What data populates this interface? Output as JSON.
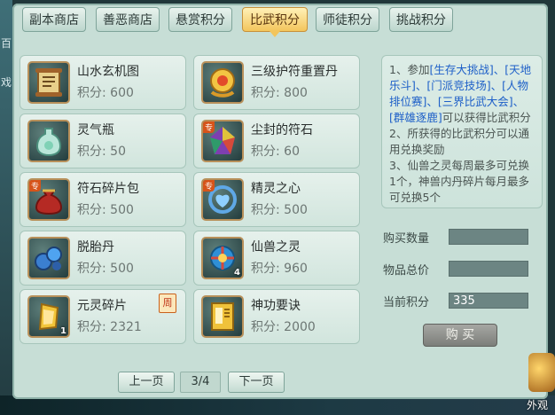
{
  "left_edge": [
    "百",
    "戏"
  ],
  "tabs": [
    {
      "label": "副本商店",
      "active": false
    },
    {
      "label": "善恶商店",
      "active": false
    },
    {
      "label": "悬赏积分",
      "active": false
    },
    {
      "label": "比武积分",
      "active": true
    },
    {
      "label": "师徒积分",
      "active": false
    },
    {
      "label": "挑战积分",
      "active": false
    }
  ],
  "items": [
    {
      "name": "山水玄机图",
      "score": "积分: 600",
      "icon": "scroll-icon"
    },
    {
      "name": "三级护符重置丹",
      "score": "积分: 800",
      "icon": "amulet-icon"
    },
    {
      "name": "灵气瓶",
      "score": "积分: 50",
      "icon": "vase-icon"
    },
    {
      "name": "尘封的符石",
      "score": "积分: 60",
      "icon": "rune-stone-icon",
      "tag": "专"
    },
    {
      "name": "符石碎片包",
      "score": "积分: 500",
      "icon": "pouch-icon",
      "tag": "专"
    },
    {
      "name": "精灵之心",
      "score": "积分: 500",
      "icon": "spirit-heart-icon",
      "tag": "专"
    },
    {
      "name": "脱胎丹",
      "score": "积分: 500",
      "icon": "pill-icon"
    },
    {
      "name": "仙兽之灵",
      "score": "积分: 960",
      "icon": "beast-orb-icon",
      "count": "4"
    },
    {
      "name": "元灵碎片",
      "score": "积分: 2321",
      "icon": "crystal-shard-icon",
      "count": "1",
      "badge": "周"
    },
    {
      "name": "神功要诀",
      "score": "积分: 2000",
      "icon": "manual-book-icon"
    }
  ],
  "description": {
    "p1_prefix": "1、参加",
    "p1_links": "[生存大挑战]、[天地乐斗]、[门派竞技场]、[人物排位赛]、[三界比武大会]、[群雄逐鹿]",
    "p1_suffix": "可以获得比武积分",
    "p2": "2、所获得的比武积分可以通用兑换奖励",
    "p3": "3、仙兽之灵每周最多可兑换1个，神兽内丹碎片每月最多可兑换5个"
  },
  "form": {
    "quantity_label": "购买数量",
    "quantity_value": "",
    "total_label": "物品总价",
    "total_value": "",
    "current_label": "当前积分",
    "current_value": "335",
    "buy_label": "购 买"
  },
  "pager": {
    "prev": "上一页",
    "page": "3/4",
    "next": "下一页"
  },
  "corner_button": "外观"
}
